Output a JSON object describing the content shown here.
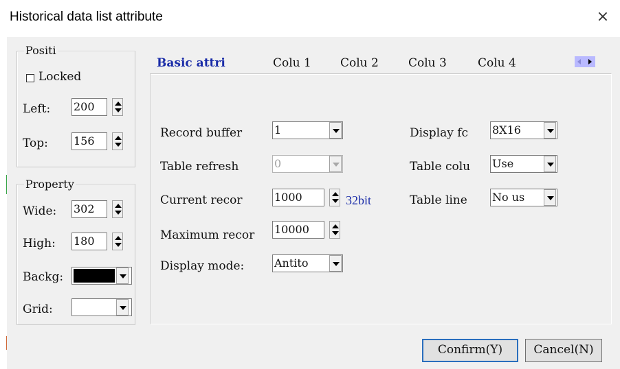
{
  "window": {
    "title": "Historical data list attribute",
    "close_glyph": "×"
  },
  "position": {
    "legend": "Positi",
    "locked_label": "Locked",
    "locked": false,
    "left_label": "Left:",
    "left_value": "200",
    "top_label": "Top:",
    "top_value": "156"
  },
  "property": {
    "legend": "Property",
    "wide_label": "Wide:",
    "wide_value": "302",
    "high_label": "High:",
    "high_value": "180",
    "backg_label": "Backg:",
    "backg_color": "#000000",
    "grid_label": "Grid:",
    "grid_color": "#ffffff"
  },
  "tabs": [
    {
      "label": "Basic attri",
      "active": true
    },
    {
      "label": "Colu 1",
      "active": false
    },
    {
      "label": "Colu 2",
      "active": false
    },
    {
      "label": "Colu 3",
      "active": false
    },
    {
      "label": "Colu 4",
      "active": false
    }
  ],
  "basic": {
    "record_buffer_label": "Record buffer",
    "record_buffer_value": "1",
    "table_refresh_label": "Table refresh",
    "table_refresh_value": "0",
    "current_record_label": "Current recor",
    "current_record_value": "1000",
    "current_record_unit": "32bit",
    "max_record_label": "Maximum recor",
    "max_record_value": "10000",
    "display_mode_label": "Display mode:",
    "display_mode_value": "Antito",
    "display_font_label": "Display fc",
    "display_font_value": "8X16",
    "table_column_label": "Table colu",
    "table_column_value": "Use",
    "table_line_label": "Table line",
    "table_line_value": "No us"
  },
  "buttons": {
    "confirm": "Confirm(Y)",
    "cancel": "Cancel(N)"
  },
  "colors": {
    "accent_text": "#1a2ca8",
    "unit_text": "#1a2ca8",
    "default_button_border": "#2a6ebd"
  }
}
